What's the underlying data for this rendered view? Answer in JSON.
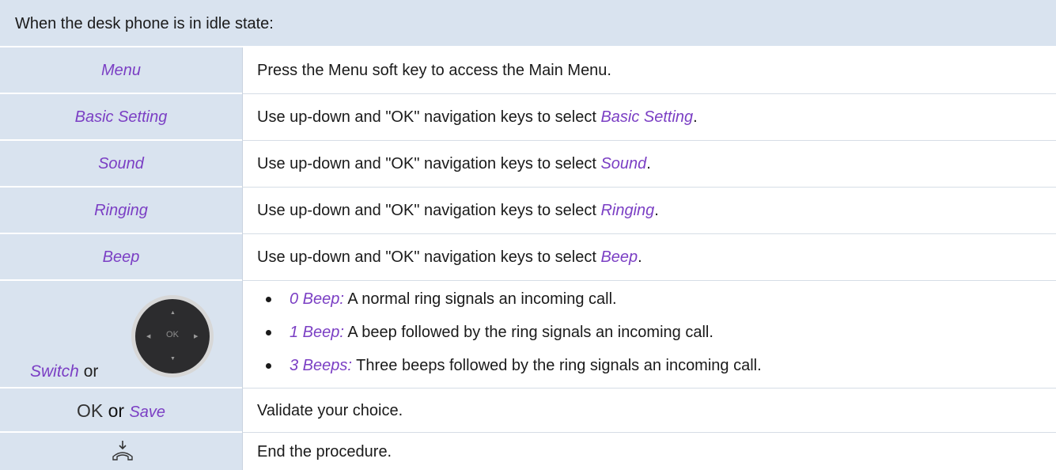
{
  "header": "When the desk phone is in idle state:",
  "rows": [
    {
      "label": "Menu",
      "text": "Press the Menu soft key to access the Main Menu."
    },
    {
      "label": "Basic Setting",
      "text_prefix": "Use up-down and \"OK\" navigation keys to select ",
      "text_emph": "Basic Setting",
      "text_suffix": "."
    },
    {
      "label": "Sound",
      "text_prefix": "Use up-down and \"OK\" navigation keys to select ",
      "text_emph": "Sound",
      "text_suffix": "."
    },
    {
      "label": "Ringing",
      "text_prefix": "Use up-down and \"OK\" navigation keys to select ",
      "text_emph": "Ringing",
      "text_suffix": "."
    },
    {
      "label": "Beep",
      "text_prefix": "Use up-down and \"OK\" navigation keys to select ",
      "text_emph": "Beep",
      "text_suffix": "."
    }
  ],
  "switch_row": {
    "switch_label": "Switch",
    "or_text": "or",
    "nav_ok": "OK",
    "bullets": [
      {
        "emph": "0 Beep:",
        "text": " A normal ring signals an incoming call."
      },
      {
        "emph": "1 Beep:",
        "text": " A beep followed by the ring signals an incoming call."
      },
      {
        "emph": "3 Beeps:",
        "text": " Three beeps followed by the ring signals an incoming call."
      }
    ]
  },
  "save_row": {
    "ok": "OK",
    "or_text": "or",
    "save": "Save",
    "text": "Validate your choice."
  },
  "end_row": {
    "icon": "hang-up-icon",
    "text": "End the procedure."
  },
  "colors": {
    "header_bg": "#d9e3ef",
    "accent": "#7b3fc4"
  }
}
